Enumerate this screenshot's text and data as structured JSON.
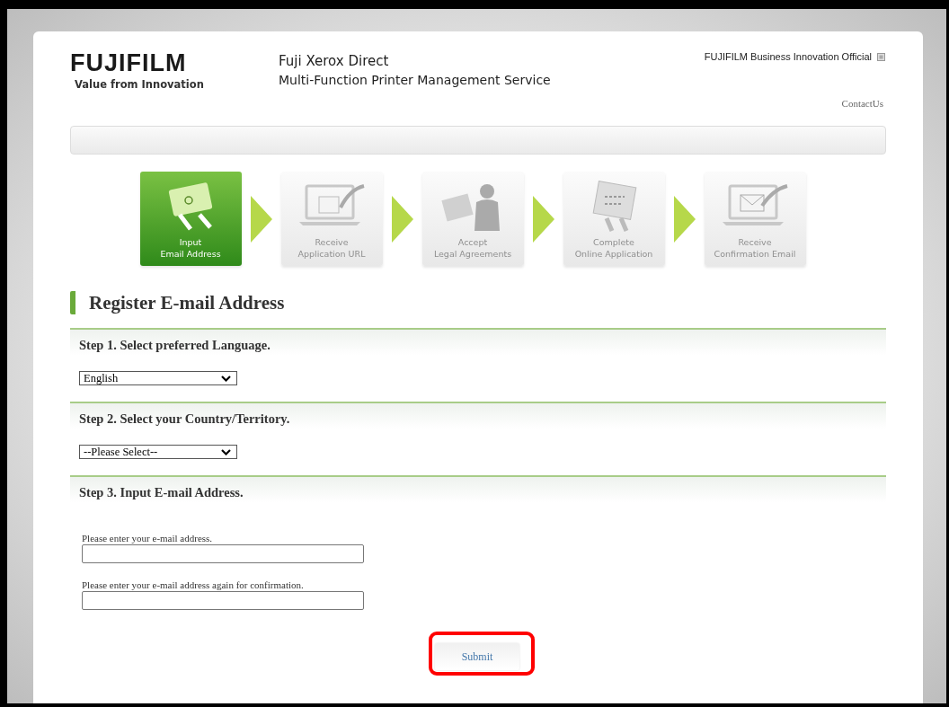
{
  "header": {
    "logo": "FUJIFILM",
    "tagline": "Value from Innovation",
    "title": "Fuji Xerox Direct",
    "subtitle": "Multi-Function Printer Management Service",
    "official_link": "FUJIFILM Business Innovation Official",
    "contact_link": "ContactUs"
  },
  "steps": [
    {
      "kind": "email",
      "label": "Input",
      "label_2": "Email Address",
      "selected": true
    },
    {
      "kind": "url",
      "label": "Receive",
      "label_2": "Application URL",
      "selected": false
    },
    {
      "kind": "legal",
      "label": "Accept",
      "label_2": "Legal Agreements",
      "selected": false
    },
    {
      "kind": "online",
      "label": "Complete",
      "label_2": "Online Application",
      "selected": false
    },
    {
      "kind": "confirm",
      "label": "Receive",
      "label_2": "Confirmation Email",
      "selected": false
    }
  ],
  "heading": "Register E-mail Address",
  "sections": [
    {
      "kind": "select",
      "title": "Step 1. Select preferred Language.",
      "value": "English"
    },
    {
      "kind": "select",
      "title": "Step 2. Select your Country/Territory.",
      "value": "--Please Select--"
    },
    {
      "kind": "inputs",
      "title": "Step 3. Input E-mail Address.",
      "fields": [
        {
          "label": "Please enter your e-mail address."
        },
        {
          "label": "Please enter your e-mail address again for confirmation."
        }
      ]
    }
  ],
  "submit": {
    "label": "Submit",
    "highlighted": true
  }
}
